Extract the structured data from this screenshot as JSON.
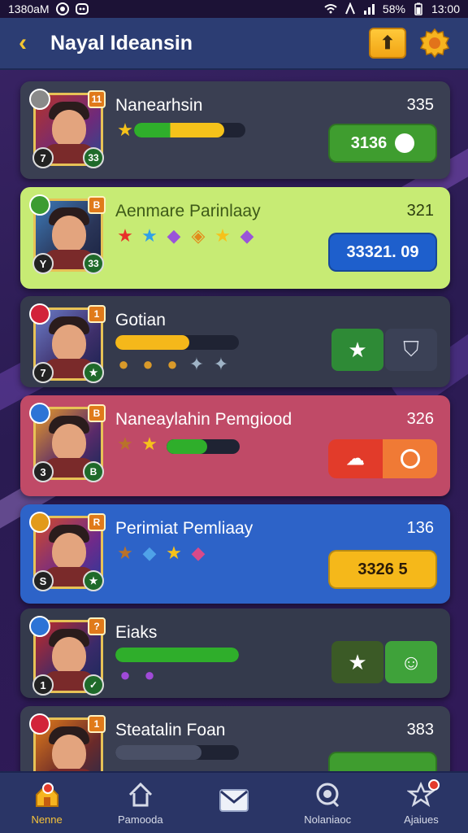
{
  "status_bar": {
    "left_text": "1380aM",
    "battery": "58%",
    "time": "13:00"
  },
  "header": {
    "title": "Nayal Ideansin",
    "back_glyph": "‹",
    "action_glyph": "⬆"
  },
  "colors": {
    "gold": "#f3c531",
    "header_bg": "#2c3d73",
    "green_button": "#3f9d2f",
    "blue_button": "#1e5fcc",
    "red_button": "#e23b2a",
    "orange_button": "#f07a35",
    "yellow_button": "#f5b81a"
  },
  "players": [
    {
      "name": "Nanearhsin",
      "score": "335",
      "badge_tr": "11",
      "badge_bl": "7",
      "badge_br": "33",
      "progress": 0.81,
      "action_label": "3136",
      "card_bg": "#3a3f52",
      "name_color": "#ffffff"
    },
    {
      "name": "Aenmare Parinlaay",
      "score": "321",
      "badge_tr": "B",
      "badge_bl": "Y",
      "badge_br": "33",
      "action_label": "33321. 09",
      "icons": [
        "red-star",
        "blue-star",
        "purple-gem",
        "shield-gem",
        "gold-star",
        "purple-gem"
      ],
      "card_bg": "#c7eb74",
      "name_color": "#3e5a18"
    },
    {
      "name": "Gotian",
      "score": "",
      "badge_tr": "1",
      "badge_bl": "7",
      "badge_br": "★",
      "progress": 0.6,
      "icons": [
        "bronze-coin",
        "bronze-coin",
        "bronze-coin",
        "silver-star",
        "silver-star"
      ],
      "card_bg": "#353a4c",
      "name_color": "#ffffff"
    },
    {
      "name": "Naneaylahin Pemgiood",
      "score": "326",
      "badge_tr": "B",
      "badge_bl": "3",
      "badge_br": "B",
      "progress": 0.55,
      "icons": [
        "bronze-star",
        "gold-star"
      ],
      "card_bg": "#c04a67",
      "name_color": "#ffffff"
    },
    {
      "name": "Perimiat Pemliaay",
      "score": "136",
      "badge_tr": "R",
      "badge_bl": "S",
      "badge_br": "★",
      "action_label": "3326  5",
      "icons": [
        "bronze-star",
        "blue-gem",
        "gold-star",
        "pink-gem"
      ],
      "card_bg": "#2d63c8",
      "name_color": "#ffffff"
    },
    {
      "name": "Eiaks",
      "score": "",
      "badge_tr": "?",
      "badge_bl": "1",
      "badge_br": "✓",
      "progress": 1.0,
      "icons": [
        "purple-orb",
        "purple-orb"
      ],
      "card_bg": "#343a4c",
      "name_color": "#ffffff"
    },
    {
      "name": "Steatalin Foan",
      "score": "383",
      "badge_tr": "1",
      "badge_bl": "",
      "badge_br": "",
      "progress": 0.7,
      "card_bg": "#3a3f52",
      "name_color": "#ffffff"
    }
  ],
  "nav": [
    {
      "label": "Nenne",
      "icon": "home-icon",
      "active": true,
      "badge": true
    },
    {
      "label": "Pamooda",
      "icon": "house-icon",
      "active": false,
      "badge": false
    },
    {
      "label": "",
      "icon": "mail-icon",
      "active": false,
      "badge": false
    },
    {
      "label": "Nolaniaoc",
      "icon": "chat-icon",
      "active": false,
      "badge": false
    },
    {
      "label": "Ajaiues",
      "icon": "trophy-icon",
      "active": false,
      "badge": true
    }
  ]
}
